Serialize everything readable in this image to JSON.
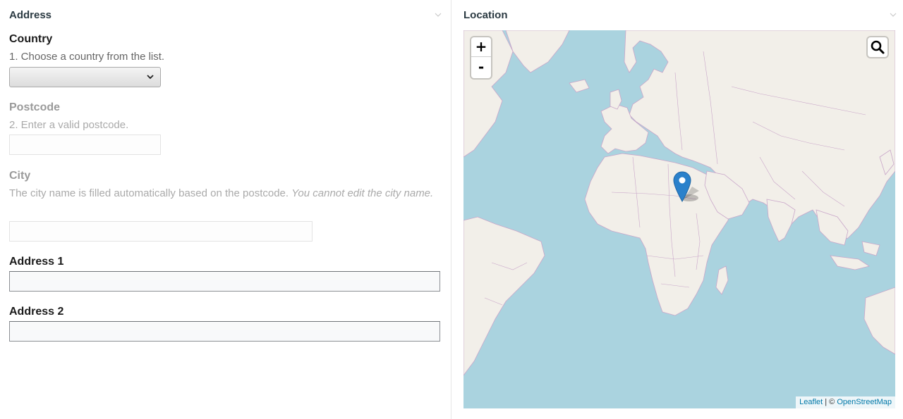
{
  "address_panel": {
    "title": "Address",
    "country": {
      "label": "Country",
      "help": "1. Choose a country from the list.",
      "value": ""
    },
    "postcode": {
      "label": "Postcode",
      "help": "2. Enter a valid postcode.",
      "value": ""
    },
    "city": {
      "label": "City",
      "help": "The city name is filled automatically based on the postcode.",
      "help_italic": "You cannot edit the city name.",
      "value": ""
    },
    "address1": {
      "label": "Address 1",
      "value": ""
    },
    "address2": {
      "label": "Address 2",
      "value": ""
    }
  },
  "location_panel": {
    "title": "Location",
    "zoom_in": "+",
    "zoom_out": "-",
    "attribution": {
      "leaflet": "Leaflet",
      "separator": " | © ",
      "osm": "OpenStreetMap"
    }
  },
  "icons": {
    "collapse": "chevron-down-icon",
    "search": "search-icon",
    "marker": "map-marker-icon"
  },
  "colors": {
    "sea": "#aad3df",
    "land": "#f2efe9",
    "border": "#c9a6c9",
    "marker": "#2a81cb",
    "link": "#0078a8"
  }
}
